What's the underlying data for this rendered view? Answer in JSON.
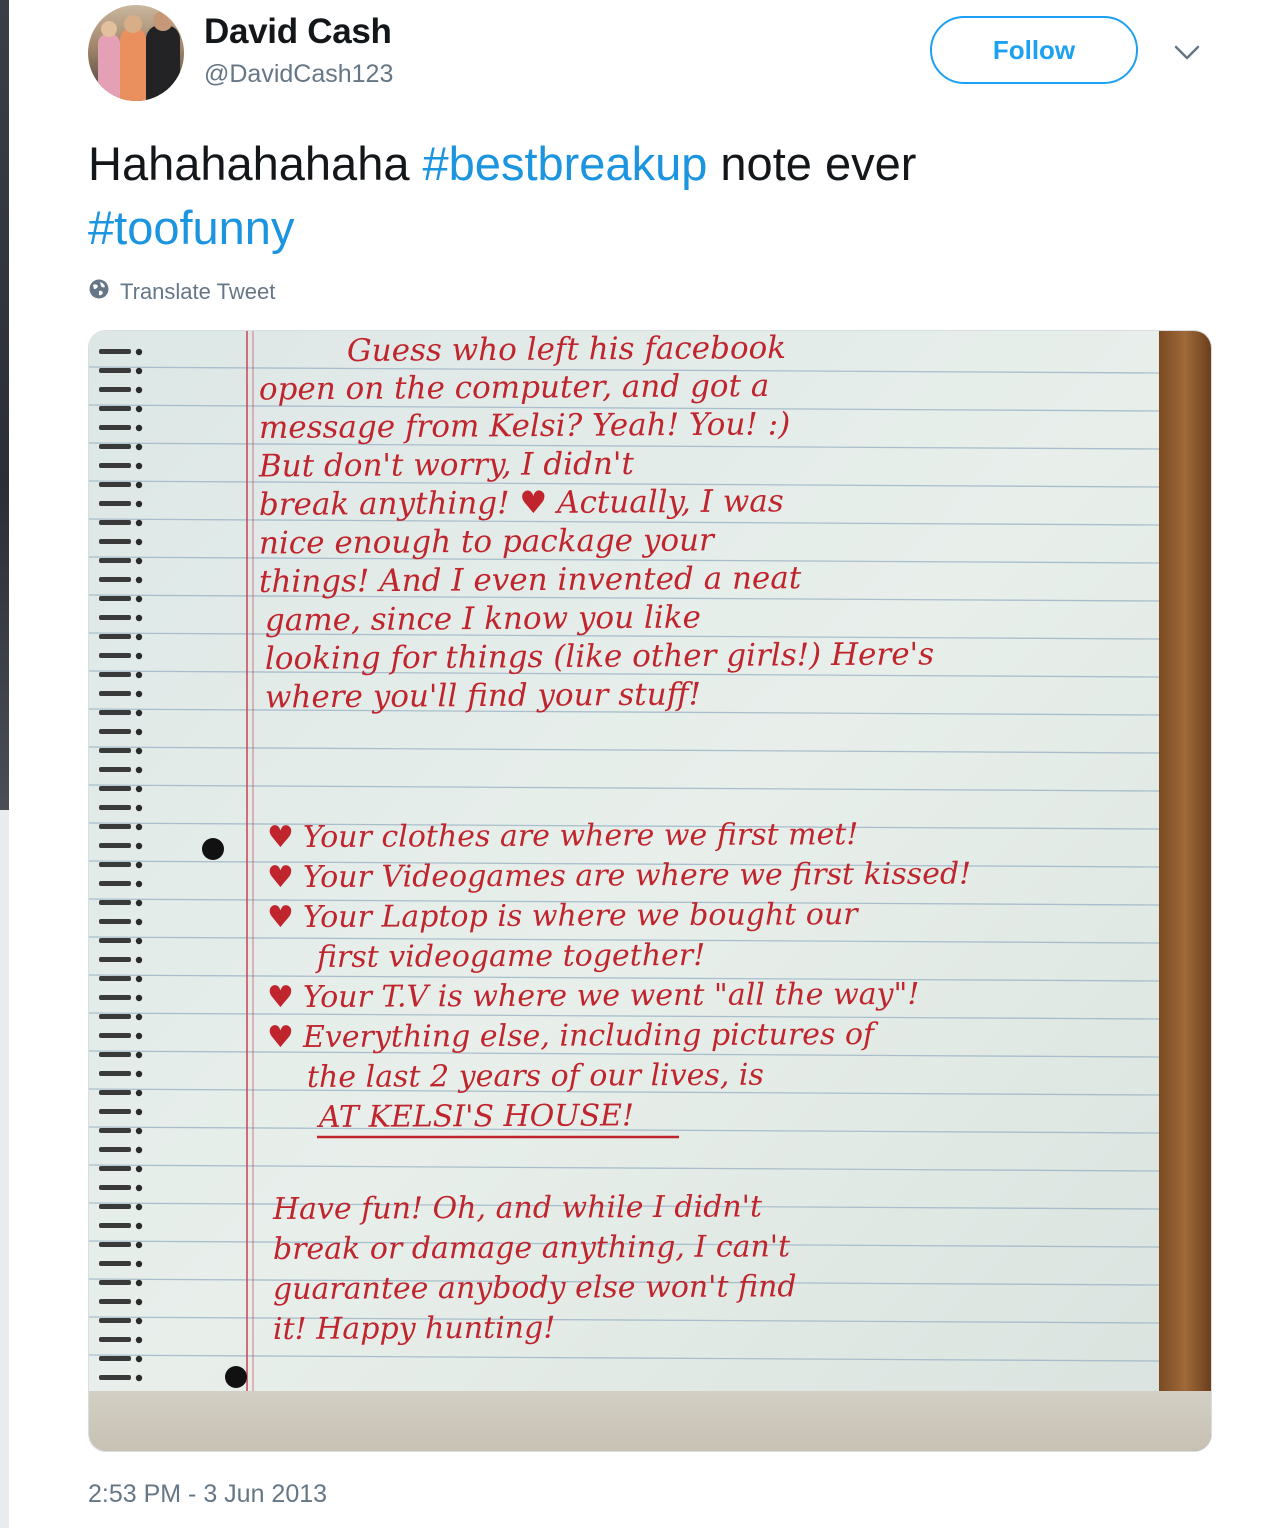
{
  "author": {
    "display_name": "David Cash",
    "handle": "@DavidCash123"
  },
  "follow_button": {
    "label": "Follow"
  },
  "menu": {
    "icon": "chevron-down-icon"
  },
  "tweet": {
    "text_plain_1": "Hahahahahaha ",
    "hashtag_1": "#bestbreakup",
    "text_plain_2": " note ever",
    "hashtag_2": "#toofunny"
  },
  "translate": {
    "icon": "globe-icon",
    "label": "Translate Tweet"
  },
  "photo": {
    "note_lines": [
      "Guess who left his facebook",
      "open on the computer, and got a",
      "message from Kelsi? Yeah! You! :)",
      "But don't worry, I didn't",
      "break anything! ♥ Actually, I was",
      "nice enough to package your",
      "things! And I even invented a neat",
      "game, since I know you like",
      "looking for things (like other girls!) Here's",
      "where you'll find your stuff!"
    ],
    "list_items": [
      "Your clothes are where we first met!",
      "Your Videogames are where we first kissed!",
      "Your Laptop is where we bought our",
      "first videogame together!",
      "Your T.V is where we went \"all the way\"!",
      "Everything else, including pictures of",
      "the last 2 years of our lives, is",
      "AT KELSI'S HOUSE!"
    ],
    "closing_lines": [
      "Have fun! Oh, and while I didn't",
      "break or damage anything, I can't",
      "guarantee anybody else won't find",
      "it! Happy hunting!"
    ],
    "colors": {
      "ink": "#c0242c",
      "paper": "#e4ece8",
      "rule": "#9fb6c9",
      "margin": "#c94e5a"
    }
  },
  "timestamp": "2:53 PM - 3 Jun 2013"
}
